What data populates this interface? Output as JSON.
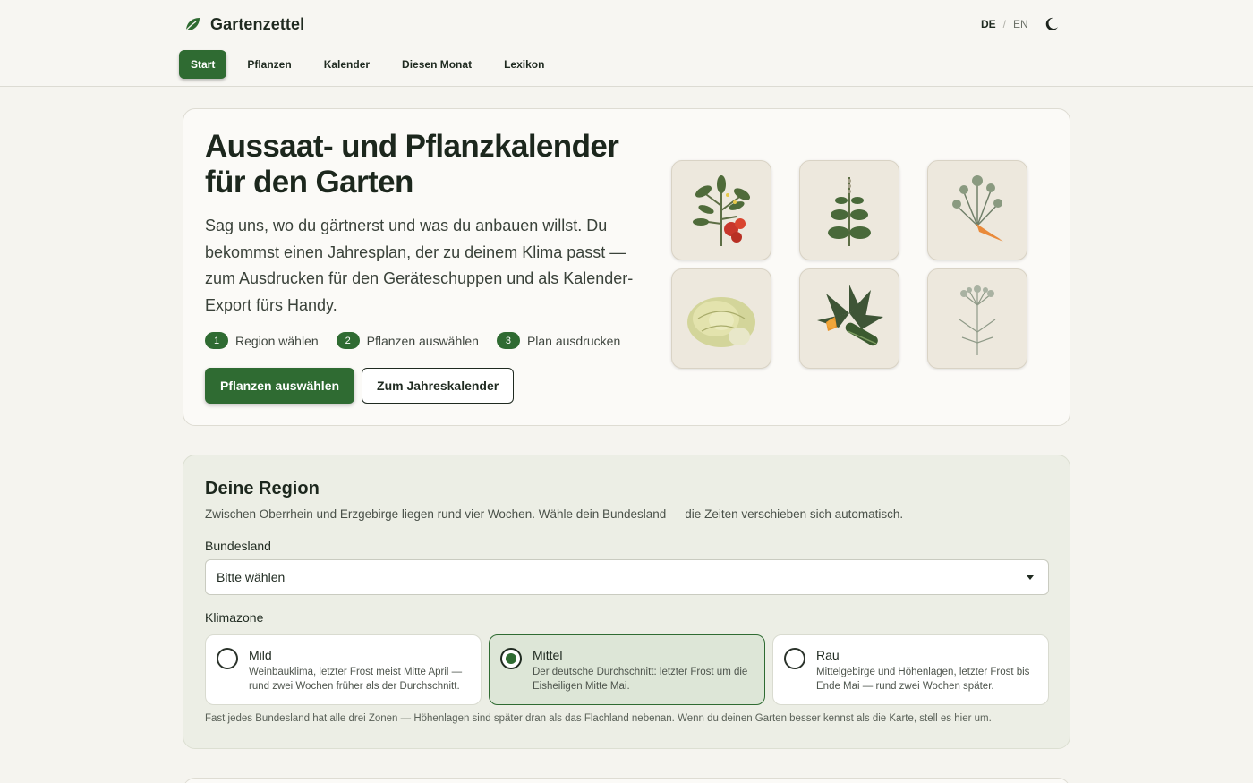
{
  "header": {
    "brand": "Gartenzettel",
    "lang_active": "DE",
    "lang_sep": "/",
    "lang_other": "EN",
    "nav": [
      {
        "label": "Start"
      },
      {
        "label": "Pflanzen"
      },
      {
        "label": "Kalender"
      },
      {
        "label": "Diesen Monat"
      },
      {
        "label": "Lexikon"
      }
    ],
    "nav_active": "Start"
  },
  "hero": {
    "title": "Aussaat- und Pflanzkalender für den Garten",
    "lead": "Sag uns, wo du gärtnerst und was du anbauen willst. Du bekommst einen Jahresplan, der zu deinem Klima passt — zum Ausdrucken für den Geräteschuppen und als Kalender-Export fürs Handy.",
    "steps": [
      {
        "num": "1",
        "label": "Region wählen"
      },
      {
        "num": "2",
        "label": "Pflanzen auswählen"
      },
      {
        "num": "3",
        "label": "Plan ausdrucken"
      }
    ],
    "primary_button": "Pflanzen auswählen",
    "secondary_button": "Zum Jahreskalender",
    "illustrations": [
      "tomato-plant",
      "basil-plant",
      "carrot-plant",
      "lettuce",
      "zucchini-plant",
      "dill-plant"
    ]
  },
  "region": {
    "title": "Deine Region",
    "description": "Zwischen Oberrhein und Erzgebirge liegen rund vier Wochen. Wähle dein Bundesland — die Zeiten verschieben sich automatisch.",
    "state_label": "Bundesland",
    "state_value": "Bitte wählen",
    "zone_label": "Klimazone",
    "zones": [
      {
        "title": "Mild",
        "desc": "Weinbauklima, letzter Frost meist Mitte April — rund zwei Wochen früher als der Durchschnitt.",
        "selected": false
      },
      {
        "title": "Mittel",
        "desc": "Der deutsche Durchschnitt: letzter Frost um die Eisheiligen Mitte Mai.",
        "selected": true
      },
      {
        "title": "Rau",
        "desc": "Mittelgebirge und Höhenlagen, letzter Frost bis Ende Mai — rund zwei Wochen später.",
        "selected": false
      }
    ],
    "hint": "Fast jedes Bundesland hat alle drei Zonen — Höhenlagen sind später dran als das Flachland nebenan. Wenn du deinen Garten besser kennst als die Karte, stell es hier um."
  },
  "colors": {
    "accent": "#2f6b32",
    "background": "#f5f4ef",
    "region_bg": "#eceee5"
  }
}
